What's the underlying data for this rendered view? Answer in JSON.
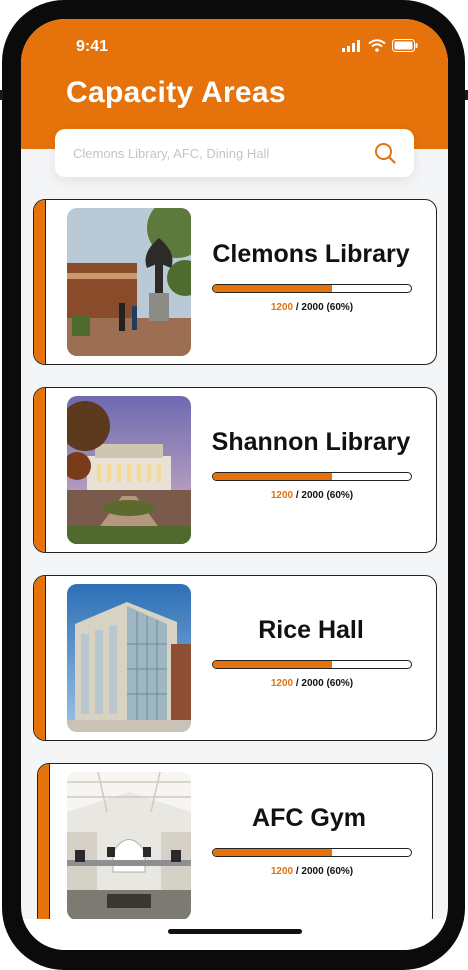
{
  "status_bar": {
    "time": "9:41",
    "icons": [
      "signal-icon",
      "wifi-icon",
      "battery-icon"
    ]
  },
  "header": {
    "title": "Capacity Areas"
  },
  "search": {
    "placeholder": "Clemons Library, AFC, Dining Hall",
    "value": "",
    "icon": "search-icon"
  },
  "colors": {
    "accent": "#e5720b",
    "background": "#f4f5f7",
    "card": "#ffffff"
  },
  "areas": [
    {
      "name": "Clemons Library",
      "current": "1200",
      "rest": " / 2000 (60%)",
      "fraction": 0.6,
      "image": "library-statue-photo"
    },
    {
      "name": "Shannon Library",
      "current": "1200",
      "rest": " / 2000 (60%)",
      "fraction": 0.6,
      "image": "library-courtyard-photo"
    },
    {
      "name": "Rice Hall",
      "current": "1200",
      "rest": " / 2000 (60%)",
      "fraction": 0.6,
      "image": "glass-building-photo"
    },
    {
      "name": "AFC Gym",
      "current": "1200",
      "rest": " / 2000 (60%)",
      "fraction": 0.6,
      "image": "gym-interior-photo"
    }
  ]
}
